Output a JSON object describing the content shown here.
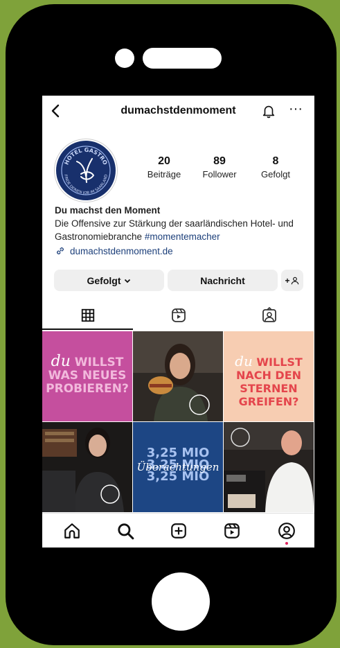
{
  "profile": {
    "username": "dumachstdenmoment",
    "display_name": "Du machst den Moment",
    "bio_line": "Die Offensive zur Stärkung der saarländischen Hotel- und Gastronomiebranche ",
    "hashtag": "#momentemacher",
    "link": "dumachstdenmoment.de",
    "avatar_text_top": "HOTEL GASTRO",
    "avatar_text_bottom": "FINDE DEINEN JOB IM SAARLAND"
  },
  "stats": [
    {
      "value": "20",
      "label": "Beiträge"
    },
    {
      "value": "89",
      "label": "Follower"
    },
    {
      "value": "8",
      "label": "Gefolgt"
    }
  ],
  "buttons": {
    "following": "Gefolgt",
    "message": "Nachricht",
    "add_user": "+"
  },
  "posts": [
    {
      "script": "du",
      "text": "WILLST WAS NEUES PROBIEREN?"
    },
    {
      "script": "du",
      "text": "WILLST NACH DEN STERNEN GREIFEN?"
    },
    {
      "script": "Überachtungen",
      "text": "3,25 MIO 3,25 MIO 3,25 MIO"
    }
  ],
  "colors": {
    "background": "#7fa23a",
    "link": "#1c3f7a",
    "post_pink": "#c54f9e",
    "post_peach": "#f7cdb2",
    "post_blue": "#1d4684"
  }
}
